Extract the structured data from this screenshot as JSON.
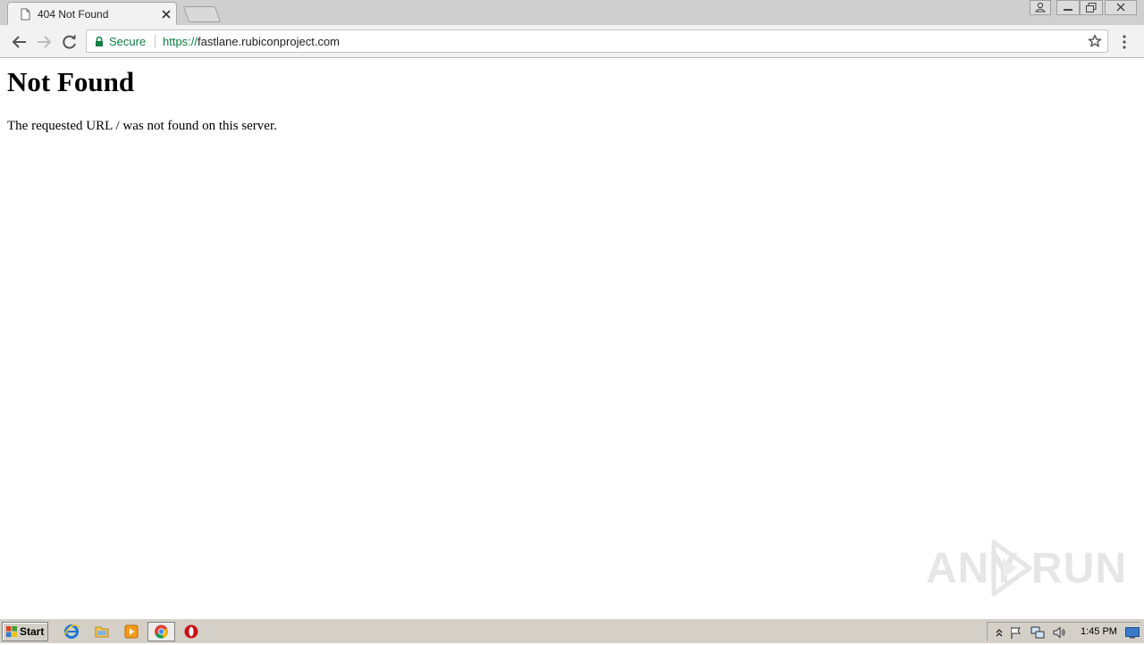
{
  "browser": {
    "tab": {
      "title": "404 Not Found"
    },
    "address_bar": {
      "security_label": "Secure",
      "url_scheme": "https://",
      "url_host": "fastlane.rubiconproject.com"
    },
    "colors": {
      "secure": "#0b8043",
      "chrome_frame": "#cfcfcf",
      "toolbar": "#f2f2f2"
    }
  },
  "page": {
    "heading": "Not Found",
    "message": "The requested URL / was not found on this server."
  },
  "watermark": {
    "left": "ANY",
    "right": "RUN"
  },
  "taskbar": {
    "start_label": "Start",
    "clock": "1:45 PM",
    "apps": [
      "internet-explorer-icon",
      "file-explorer-icon",
      "media-player-icon",
      "chrome-icon",
      "opera-icon"
    ],
    "tray_icons": [
      "show-hidden-icons-icon",
      "action-center-flag-icon",
      "network-icon",
      "volume-icon",
      "show-desktop-icon"
    ]
  }
}
